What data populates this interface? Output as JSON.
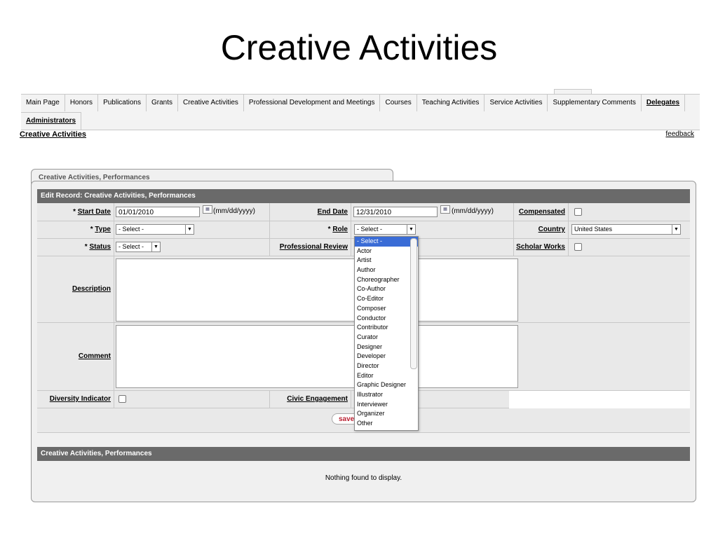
{
  "slide_title": "Creative Activities",
  "nav": {
    "row1": [
      "Main Page",
      "Honors",
      "Publications",
      "Grants",
      "Creative Activities",
      "Professional Development and Meetings",
      "Courses",
      "Teaching Activities",
      "Service Activities",
      "Supplementary Comments",
      "Delegates"
    ],
    "row2": [
      "Administrators"
    ]
  },
  "breadcrumb": "Creative Activities",
  "feedback": "feedback",
  "panel_tab": "Creative Activities, Performances",
  "edit_header": "Edit Record: Creative Activities, Performances",
  "form": {
    "start_date_label": "Start Date",
    "start_date_value": "01/01/2010",
    "date_format": "(mm/dd/yyyy)",
    "end_date_label": "End Date",
    "end_date_value": "12/31/2010",
    "compensated_label": "Compensated",
    "type_label": "Type",
    "type_value": "- Select -",
    "role_label": "Role",
    "role_value": "- Select -",
    "country_label": "Country",
    "country_value": "United States",
    "status_label": "Status",
    "status_value": "- Select -",
    "professional_review_label": "Professional Review",
    "scholar_works_label": "Scholar Works",
    "description_label": "Description",
    "comment_label": "Comment",
    "diversity_label": "Diversity Indicator",
    "civic_label": "Civic Engagement",
    "required_mark": "*",
    "save_label": "save"
  },
  "role_options": [
    "- Select -",
    "Actor",
    "Artist",
    "Author",
    "Choreographer",
    "Co-Author",
    "Co-Editor",
    "Composer",
    "Conductor",
    "Contributor",
    "Curator",
    "Designer",
    "Developer",
    "Director",
    "Editor",
    "Graphic Designer",
    "Illustrator",
    "Interviewer",
    "Organizer",
    "Other"
  ],
  "list_header": "Creative Activities, Performances",
  "empty_message": "Nothing found to display."
}
